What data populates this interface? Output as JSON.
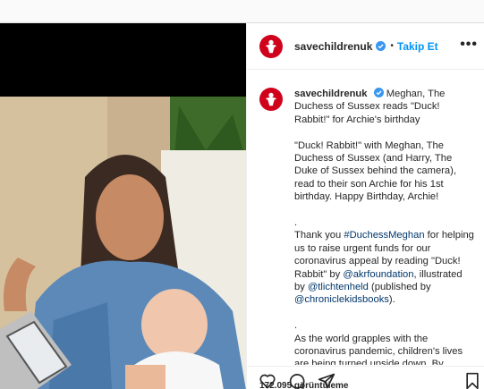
{
  "account": {
    "username": "savechildrenuk",
    "follow_label": "Takip Et",
    "dot": "•",
    "more": "•••"
  },
  "caption": {
    "headline": "Meghan, The Duchess of Sussex reads \"Duck! Rabbit!\" for Archie's birthday",
    "p1": "\"Duck! Rabbit!\" with Meghan, The Duchess of Sussex (and Harry, The Duke of Sussex behind the camera), read to their son Archie for his 1st birthday. Happy Birthday, Archie!",
    "sep1": ".",
    "p2_a": "Thank you ",
    "p2_tag1": "#DuchessMeghan",
    "p2_b": " for helping us to raise urgent funds for our coronavirus appeal by reading \"Duck! Rabbit\" by ",
    "p2_tag2": "@akrfoundation",
    "p2_c": ", illustrated by ",
    "p2_tag3": "@tlichtenheld",
    "p2_d": " (published by ",
    "p2_tag4": "@chroniclekidsbooks",
    "p2_e": ").",
    "sep2": ".",
    "p3": "As the world grapples with the coronavirus pandemic, children's lives are being turned upside down. By"
  },
  "stats": {
    "views": "172.095 görüntüleme"
  },
  "colors": {
    "brand_red": "#d0021b",
    "link_blue": "#0095f6",
    "tag_blue": "#00376b"
  },
  "icons": [
    "heart-icon",
    "comment-icon",
    "share-icon",
    "bookmark-icon",
    "verified-icon",
    "save-the-children-logo"
  ]
}
